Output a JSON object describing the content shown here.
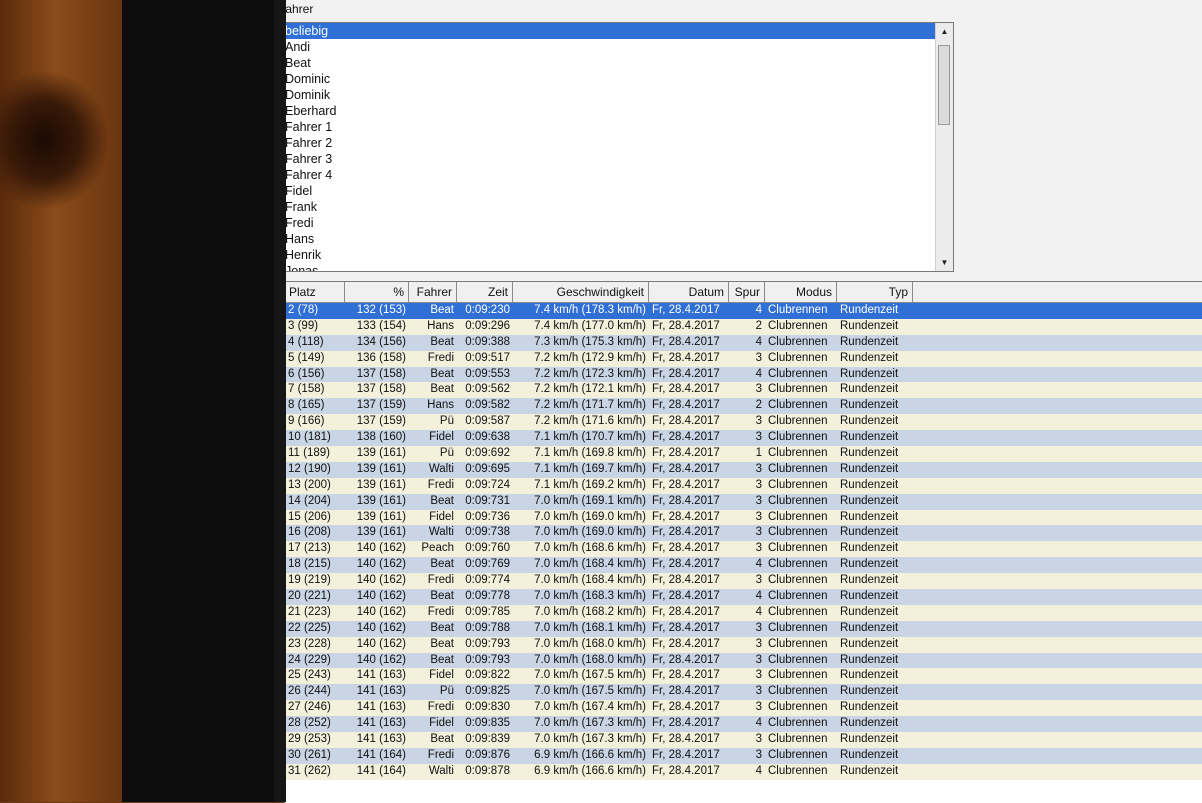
{
  "group_label": "Fahrer",
  "drivers": [
    "beliebig",
    "Andi",
    "Beat",
    "Dominic",
    "Dominik",
    "Eberhard",
    "Fahrer 1",
    "Fahrer 2",
    "Fahrer 3",
    "Fahrer 4",
    "Fidel",
    "Frank",
    "Fredi",
    "Hans",
    "Henrik",
    "Jonas"
  ],
  "selected_driver": "beliebig",
  "scroll": {
    "up_icon": "▲",
    "grip_icon": "≡",
    "down_icon": "▼"
  },
  "columns": [
    "Platz",
    "%",
    "Fahrer",
    "Zeit",
    "Geschwindigkeit",
    "Datum",
    "Spur",
    "Modus",
    "Typ"
  ],
  "rows": [
    [
      "2 (78)",
      "132 (153)",
      "Beat",
      "0:09:230",
      "7.4 km/h (178.3 km/h)",
      "Fr, 28.4.2017",
      "4",
      "Clubrennen",
      "Rundenzeit"
    ],
    [
      "3 (99)",
      "133 (154)",
      "Hans",
      "0:09:296",
      "7.4 km/h (177.0 km/h)",
      "Fr, 28.4.2017",
      "2",
      "Clubrennen",
      "Rundenzeit"
    ],
    [
      "4 (118)",
      "134 (156)",
      "Beat",
      "0:09:388",
      "7.3 km/h (175.3 km/h)",
      "Fr, 28.4.2017",
      "4",
      "Clubrennen",
      "Rundenzeit"
    ],
    [
      "5 (149)",
      "136 (158)",
      "Fredi",
      "0:09:517",
      "7.2 km/h (172.9 km/h)",
      "Fr, 28.4.2017",
      "3",
      "Clubrennen",
      "Rundenzeit"
    ],
    [
      "6 (156)",
      "137 (158)",
      "Beat",
      "0:09:553",
      "7.2 km/h (172.3 km/h)",
      "Fr, 28.4.2017",
      "4",
      "Clubrennen",
      "Rundenzeit"
    ],
    [
      "7 (158)",
      "137 (158)",
      "Beat",
      "0:09:562",
      "7.2 km/h (172.1 km/h)",
      "Fr, 28.4.2017",
      "3",
      "Clubrennen",
      "Rundenzeit"
    ],
    [
      "8 (165)",
      "137 (159)",
      "Hans",
      "0:09:582",
      "7.2 km/h (171.7 km/h)",
      "Fr, 28.4.2017",
      "2",
      "Clubrennen",
      "Rundenzeit"
    ],
    [
      "9 (166)",
      "137 (159)",
      "Pü",
      "0:09:587",
      "7.2 km/h (171.6 km/h)",
      "Fr, 28.4.2017",
      "3",
      "Clubrennen",
      "Rundenzeit"
    ],
    [
      "10 (181)",
      "138 (160)",
      "Fidel",
      "0:09:638",
      "7.1 km/h (170.7 km/h)",
      "Fr, 28.4.2017",
      "3",
      "Clubrennen",
      "Rundenzeit"
    ],
    [
      "11 (189)",
      "139 (161)",
      "Pü",
      "0:09:692",
      "7.1 km/h (169.8 km/h)",
      "Fr, 28.4.2017",
      "1",
      "Clubrennen",
      "Rundenzeit"
    ],
    [
      "12 (190)",
      "139 (161)",
      "Walti",
      "0:09:695",
      "7.1 km/h (169.7 km/h)",
      "Fr, 28.4.2017",
      "3",
      "Clubrennen",
      "Rundenzeit"
    ],
    [
      "13 (200)",
      "139 (161)",
      "Fredi",
      "0:09:724",
      "7.1 km/h (169.2 km/h)",
      "Fr, 28.4.2017",
      "3",
      "Clubrennen",
      "Rundenzeit"
    ],
    [
      "14 (204)",
      "139 (161)",
      "Beat",
      "0:09:731",
      "7.0 km/h (169.1 km/h)",
      "Fr, 28.4.2017",
      "3",
      "Clubrennen",
      "Rundenzeit"
    ],
    [
      "15 (206)",
      "139 (161)",
      "Fidel",
      "0:09:736",
      "7.0 km/h (169.0 km/h)",
      "Fr, 28.4.2017",
      "3",
      "Clubrennen",
      "Rundenzeit"
    ],
    [
      "16 (208)",
      "139 (161)",
      "Walti",
      "0:09:738",
      "7.0 km/h (169.0 km/h)",
      "Fr, 28.4.2017",
      "3",
      "Clubrennen",
      "Rundenzeit"
    ],
    [
      "17 (213)",
      "140 (162)",
      "Peach",
      "0:09:760",
      "7.0 km/h (168.6 km/h)",
      "Fr, 28.4.2017",
      "3",
      "Clubrennen",
      "Rundenzeit"
    ],
    [
      "18 (215)",
      "140 (162)",
      "Beat",
      "0:09:769",
      "7.0 km/h (168.4 km/h)",
      "Fr, 28.4.2017",
      "4",
      "Clubrennen",
      "Rundenzeit"
    ],
    [
      "19 (219)",
      "140 (162)",
      "Fredi",
      "0:09:774",
      "7.0 km/h (168.4 km/h)",
      "Fr, 28.4.2017",
      "3",
      "Clubrennen",
      "Rundenzeit"
    ],
    [
      "20 (221)",
      "140 (162)",
      "Beat",
      "0:09:778",
      "7.0 km/h (168.3 km/h)",
      "Fr, 28.4.2017",
      "4",
      "Clubrennen",
      "Rundenzeit"
    ],
    [
      "21 (223)",
      "140 (162)",
      "Fredi",
      "0:09:785",
      "7.0 km/h (168.2 km/h)",
      "Fr, 28.4.2017",
      "4",
      "Clubrennen",
      "Rundenzeit"
    ],
    [
      "22 (225)",
      "140 (162)",
      "Beat",
      "0:09:788",
      "7.0 km/h (168.1 km/h)",
      "Fr, 28.4.2017",
      "3",
      "Clubrennen",
      "Rundenzeit"
    ],
    [
      "23 (228)",
      "140 (162)",
      "Beat",
      "0:09:793",
      "7.0 km/h (168.0 km/h)",
      "Fr, 28.4.2017",
      "3",
      "Clubrennen",
      "Rundenzeit"
    ],
    [
      "24 (229)",
      "140 (162)",
      "Beat",
      "0:09:793",
      "7.0 km/h (168.0 km/h)",
      "Fr, 28.4.2017",
      "3",
      "Clubrennen",
      "Rundenzeit"
    ],
    [
      "25 (243)",
      "141 (163)",
      "Fidel",
      "0:09:822",
      "7.0 km/h (167.5 km/h)",
      "Fr, 28.4.2017",
      "3",
      "Clubrennen",
      "Rundenzeit"
    ],
    [
      "26 (244)",
      "141 (163)",
      "Pü",
      "0:09:825",
      "7.0 km/h (167.5 km/h)",
      "Fr, 28.4.2017",
      "3",
      "Clubrennen",
      "Rundenzeit"
    ],
    [
      "27 (246)",
      "141 (163)",
      "Fredi",
      "0:09:830",
      "7.0 km/h (167.4 km/h)",
      "Fr, 28.4.2017",
      "3",
      "Clubrennen",
      "Rundenzeit"
    ],
    [
      "28 (252)",
      "141 (163)",
      "Fidel",
      "0:09:835",
      "7.0 km/h (167.3 km/h)",
      "Fr, 28.4.2017",
      "4",
      "Clubrennen",
      "Rundenzeit"
    ],
    [
      "29 (253)",
      "141 (163)",
      "Beat",
      "0:09:839",
      "7.0 km/h (167.3 km/h)",
      "Fr, 28.4.2017",
      "3",
      "Clubrennen",
      "Rundenzeit"
    ],
    [
      "30 (261)",
      "141 (164)",
      "Fredi",
      "0:09:876",
      "6.9 km/h (166.6 km/h)",
      "Fr, 28.4.2017",
      "3",
      "Clubrennen",
      "Rundenzeit"
    ],
    [
      "31 (262)",
      "141 (164)",
      "Walti",
      "0:09:878",
      "6.9 km/h (166.6 km/h)",
      "Fr, 28.4.2017",
      "4",
      "Clubrennen",
      "Rundenzeit"
    ]
  ],
  "colors": {
    "selection": "#2f6fd6",
    "row_alt": "#c9d4e4",
    "row_even": "#f3f0dc"
  }
}
